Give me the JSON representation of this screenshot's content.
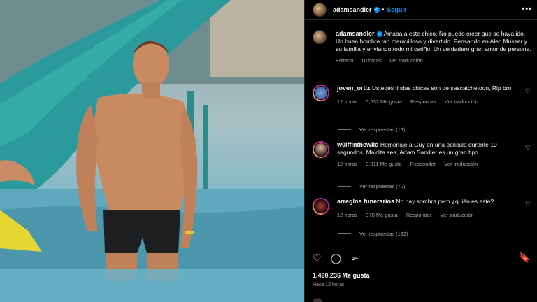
{
  "header": {
    "username": "adamsandler",
    "follow_label": "Seguir",
    "more_label": "•••"
  },
  "caption": {
    "username": "adamsandler",
    "text": "Amaba a este chico. No puedo creer que se haya ido. Un buen hombre tan maravilloso y divertido. Pensando en Alec Musser y su familia y enviando todo mi cariño. Un verdadero gran amor de persona.",
    "edited": "Editado",
    "time": "10 horas",
    "translate": "Ver traducción"
  },
  "comments": [
    {
      "username": "joven_ortiz",
      "text": "Ustedes lindas chicas son de sascatchetoon, Rip bro",
      "time": "12 horas",
      "likes": "5,532 Me gusta",
      "reply": "Responder",
      "translate": "Ver traducción",
      "replies": "Ver respuestas (13)"
    },
    {
      "username": "w0lffinthewild",
      "text": "Homenaje a Guy en una película durante 10 segundos. Maldita sea, Adam Sandler es un gran tipo.",
      "time": "12 horas",
      "likes": "9,311 Me gusta",
      "reply": "Responder",
      "translate": "Ver traducción",
      "replies": "Ver respuestas (70)"
    },
    {
      "username": "arreglos funerarios",
      "text": "No hay sombra pero ¿quién es este?",
      "time": "12 horas",
      "likes": "375 Me gusta",
      "reply": "Responder",
      "translate": "Ver traducción",
      "replies": "Ver respuestas (192)"
    }
  ],
  "footer": {
    "likes": "1.490.236 Me gusta",
    "time_ago": "Hace 12 horas"
  },
  "colors": {
    "accent": "#0095f6",
    "muted": "#a8a8a8",
    "background": "#000000"
  }
}
